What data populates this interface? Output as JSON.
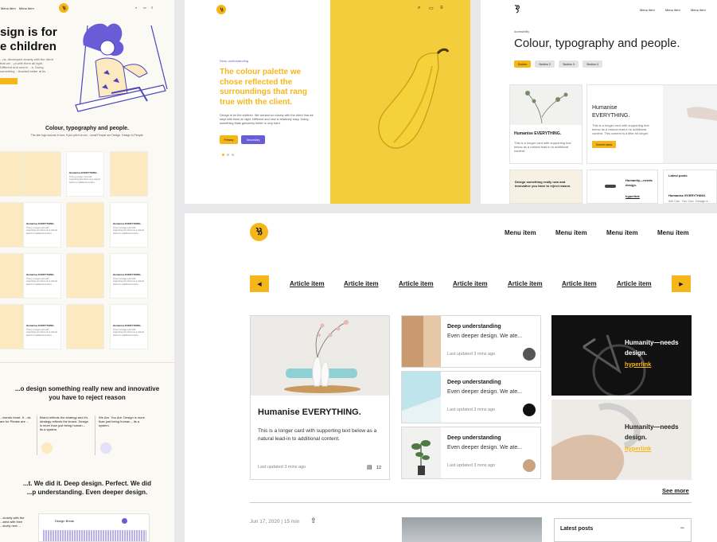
{
  "colors": {
    "accent": "#f5b619",
    "purple": "#6a5bd6",
    "banana_bg": "#f3cd3c",
    "dark": "#111111"
  },
  "panel1": {
    "menu": [
      "Menu item",
      "Menu item"
    ],
    "hero": [
      "sign is for",
      "e children"
    ],
    "hero_desc": "...ns, developed closely with the client that we ...pt with them all right. Different and new in ...k. Doing something ...ttracted better at its ...",
    "hero_btn": "...",
    "section_title": "Colour, typography and people.",
    "section_sub": "The site logo sounds it now. If you pitch an ad ...small People are Design. Design is People.",
    "card_title": "Humanise EVERYTHING.",
    "card_text": "This is a longer card with supporting text below as a natural lead-in to additional content.",
    "quote": [
      "...o design something really new and innovative",
      "you have to reject reason"
    ],
    "col1": "...esents heart. It ...ds are for Please are ...",
    "col2": "Brand reflects the strategy and it's strategy reflects the brand. Design is more than just being human – its a system.",
    "col3": "We Are. You Are. Design is more than just being human – its a system.",
    "quote2": [
      "...t. We did it. Deep design. Perfect. We did",
      "...p understanding. Even deeper design."
    ],
    "bottom_left": [
      "...closely with the ...ated with their ...sively new ..."
    ],
    "bottom_card": "Design Break"
  },
  "panel2": {
    "kicker": "Deep understanding",
    "headline": "The colour palette we chose reflected the surroundings that rang true with the client.",
    "body": "Design is for the children. We worked so closely with the client that we slept with them at night. Different and new in relatively easy. Doing something thats genuinely better is very hard.",
    "btn_primary": "Primary",
    "btn_secondary": "Secondary"
  },
  "panel3": {
    "menu": [
      "Menu item",
      "Menu item",
      "Menu item"
    ],
    "crumb": "Accessibility",
    "headline": "Colour, typography and people.",
    "tabs": [
      "Section",
      "Section 2",
      "Section 3",
      "Section 4"
    ],
    "card_title": "Humanise EVERYTHING.",
    "card_text": "This is a longer card with supporting text below as a natural lead-in to additional content.",
    "feature_title": "Humanise EVERYTHING.",
    "feature_text": "This is a longer card with supporting text below as a natural lead-in to additional content. This content is a little bit longer.",
    "feature_btn": "Submit Ideas",
    "note": "Design something really new and innovative you have to reject reason.",
    "mini_title": "Humanity—needs design.",
    "mini_link": "hyperlink",
    "latest": "Latest posts",
    "latest_item": "Humanise EVERYTHING.",
    "latest_meta": "We Can. You Can. Design it..."
  },
  "panel4": {
    "menu": [
      "Menu item",
      "Menu item",
      "Menu item",
      "Menu item"
    ],
    "articles": [
      "Article item",
      "Article item",
      "Article item",
      "Article item",
      "Article item",
      "Article item",
      "Article item"
    ],
    "big_card": {
      "title": "Humanise EVERYTHING.",
      "text": "This is a longer card with supporting text below as a natural lead-in to additional content.",
      "updated": "Last updated 3 mins ago",
      "comments": "12"
    },
    "small_cards": [
      {
        "title": "Deep understanding",
        "text": "Even deeper design. We ate...",
        "updated": "Last updated 3 mins ago"
      },
      {
        "title": "Deep understanding",
        "text": "Even deeper design. We ate...",
        "updated": "Last updated 3 mins ago"
      },
      {
        "title": "Deep understanding",
        "text": "Even deeper design. We ate...",
        "updated": "Last updated 3 mins ago"
      }
    ],
    "dark_cards": [
      {
        "title": "Humanity—needs design.",
        "link": "hyperlink"
      },
      {
        "title": "Humanity—needs design.",
        "link": "hyperlink"
      }
    ],
    "see_more": "See more",
    "date": "Jun 17, 2020 | 15 min",
    "latest_posts": "Latest posts"
  }
}
